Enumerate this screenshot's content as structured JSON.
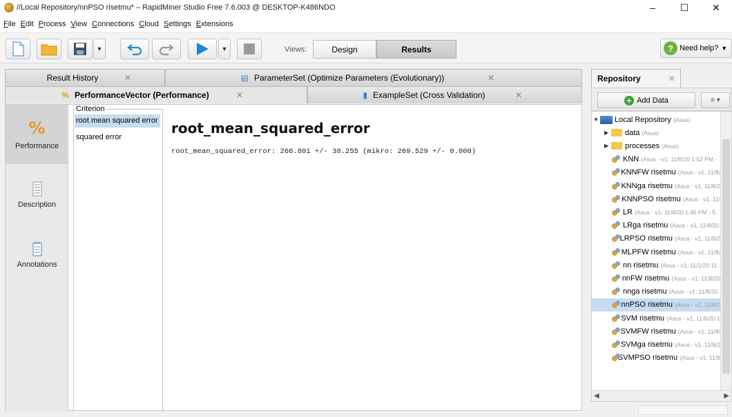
{
  "window": {
    "title": "//Local Repository/nnPSO risetmu* – RapidMiner Studio Free 7.6.003 @ DESKTOP-K486NDO",
    "minimize": "–",
    "maximize": "☐",
    "close": "✕"
  },
  "menu": [
    "File",
    "Edit",
    "Process",
    "View",
    "Connections",
    "Cloud",
    "Settings",
    "Extensions"
  ],
  "toolbar": {
    "views_label": "Views:",
    "design_label": "Design",
    "results_label": "Results",
    "help_label": "Need help?"
  },
  "tabs": {
    "row1": [
      {
        "label": "Result History",
        "close": "✕"
      },
      {
        "label": "ParameterSet (Optimize Parameters (Evolutionary))",
        "close": "✕"
      }
    ],
    "row2": [
      {
        "label": "PerformanceVector (Performance)",
        "close": "✕"
      },
      {
        "label": "ExampleSet (Cross Validation)",
        "close": "✕"
      }
    ]
  },
  "sidenav": [
    {
      "label": "Performance",
      "icon": "percent-icon"
    },
    {
      "label": "Description",
      "icon": "document-icon"
    },
    {
      "label": "Annotations",
      "icon": "notes-icon"
    }
  ],
  "criterion": {
    "legend": "Criterion",
    "items": [
      "root mean squared error",
      "squared error"
    ],
    "selected": 0
  },
  "performance": {
    "title": "root_mean_squared_error",
    "value_line": "root_mean_squared_error: 266.801 +/- 38.255 (mikro: 269.529 +/- 0.000)"
  },
  "repository": {
    "tab_label": "Repository",
    "tab_close": "✕",
    "add_data": "Add Data",
    "menu_glyph": "≡ ▾",
    "tree": [
      {
        "label": "Local Repository",
        "meta": "(Asus)",
        "type": "repo",
        "depth": 0,
        "caret": "▼"
      },
      {
        "label": "data",
        "meta": "(Asus)",
        "type": "folder",
        "depth": 1,
        "caret": "▶"
      },
      {
        "label": "processes",
        "meta": "(Asus)",
        "type": "folder",
        "depth": 1,
        "caret": "▶"
      },
      {
        "label": "KNN",
        "meta": "(Asus - v1, 11/8/20 1:52 PM -",
        "type": "process",
        "depth": 2
      },
      {
        "label": "KNNFW risetmu",
        "meta": "(Asus - v1, 11/8/",
        "type": "process",
        "depth": 2
      },
      {
        "label": "KNNga risetmu",
        "meta": "(Asus - v1, 11/8/2",
        "type": "process",
        "depth": 2
      },
      {
        "label": "KNNPSO risetmu",
        "meta": "(Asus - v1, 11/",
        "type": "process",
        "depth": 2
      },
      {
        "label": "LR",
        "meta": "(Asus - v1, 11/8/20 1:45 PM - 5",
        "type": "process",
        "depth": 2
      },
      {
        "label": "LRga risetmu",
        "meta": "(Asus - v1, 11/8/20",
        "type": "process",
        "depth": 2
      },
      {
        "label": "LRPSO risetmu",
        "meta": "(Asus - v1, 11/8/2",
        "type": "process",
        "depth": 2
      },
      {
        "label": "MLPFW risetmu",
        "meta": "(Asus - v1, 11/8/",
        "type": "process",
        "depth": 2
      },
      {
        "label": "nn risetmu",
        "meta": "(Asus - v1, 11/1/20 11:",
        "type": "process",
        "depth": 2
      },
      {
        "label": "nnFW risetmu",
        "meta": "(Asus - v1, 11/8/20",
        "type": "process",
        "depth": 2
      },
      {
        "label": "nnga risetmu",
        "meta": "(Asus - v1, 11/8/20",
        "type": "process",
        "depth": 2
      },
      {
        "label": "nnPSO risetmu",
        "meta": "(Asus - v1, 11/8/2",
        "type": "process",
        "depth": 2,
        "selected": true
      },
      {
        "label": "SVM risetmu",
        "meta": "(Asus - v1, 11/8/20 1",
        "type": "process",
        "depth": 2
      },
      {
        "label": "SVMFW risetmu",
        "meta": "(Asus - v1, 11/8/",
        "type": "process",
        "depth": 2
      },
      {
        "label": "SVMga risetmu",
        "meta": "(Asus - v1, 11/8/2",
        "type": "process",
        "depth": 2
      },
      {
        "label": "SVMPSO risetmu",
        "meta": "(Asus - v1, 11/8",
        "type": "process",
        "depth": 2
      }
    ]
  },
  "colors": {
    "selection": "#c7dcf2",
    "play_blue": "#1e88d8",
    "accent_orange": "#e09a1f",
    "help_green": "#6db23a"
  }
}
